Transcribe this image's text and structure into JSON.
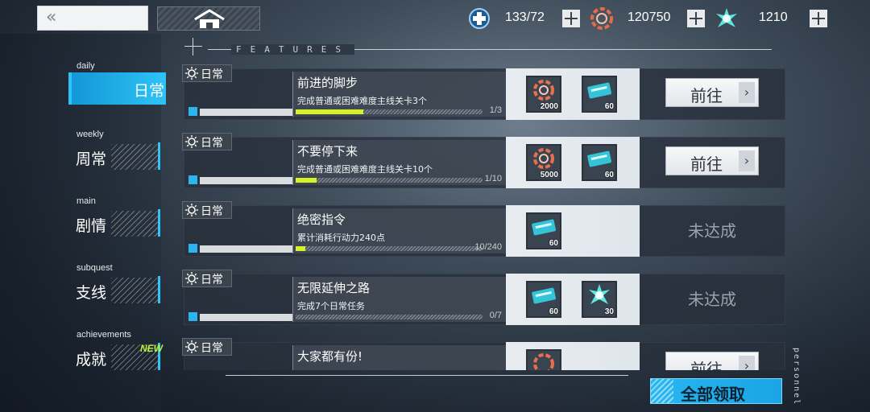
{
  "header": {
    "back_icon": "«",
    "resources": [
      {
        "name": "stamina",
        "icon": "medical-cross-icon",
        "value": "133/72"
      },
      {
        "name": "credits",
        "icon": "gear-coin-icon",
        "value": "120750"
      },
      {
        "name": "crystal",
        "icon": "crystal-burst-icon",
        "value": "1210"
      }
    ]
  },
  "features_label": "FEATURES",
  "nav": [
    {
      "en": "daily",
      "zh": "日常",
      "active": true
    },
    {
      "en": "weekly",
      "zh": "周常"
    },
    {
      "en": "main",
      "zh": "剧情"
    },
    {
      "en": "subquest",
      "zh": "支线"
    },
    {
      "en": "achievements",
      "zh": "成就",
      "badge": "NEW"
    }
  ],
  "tasks": [
    {
      "tag": "日常",
      "title": "前进的脚步",
      "desc": "完成普通或困难难度主线关卡3个",
      "progress": "1/3",
      "progress_fraction": 0.333,
      "rewards": [
        {
          "icon": "gear-coin-icon",
          "qty": "2000"
        },
        {
          "icon": "ticket-card-icon",
          "qty": "60"
        }
      ],
      "action": "前往"
    },
    {
      "tag": "日常",
      "title": "不要停下来",
      "desc": "完成普通或困难难度主线关卡10个",
      "progress": "1/10",
      "progress_fraction": 0.1,
      "rewards": [
        {
          "icon": "gear-coin-icon",
          "qty": "5000"
        },
        {
          "icon": "ticket-card-icon",
          "qty": "60"
        }
      ],
      "action": "前往"
    },
    {
      "tag": "日常",
      "title": "绝密指令",
      "desc": "累计消耗行动力240点",
      "progress": "10/240",
      "progress_fraction": 0.042,
      "rewards": [
        {
          "icon": "ticket-card-icon",
          "qty": "60"
        }
      ],
      "status": "未达成"
    },
    {
      "tag": "日常",
      "title": "无限延伸之路",
      "desc": "完成7个日常任务",
      "progress": "0/7",
      "progress_fraction": 0,
      "rewards": [
        {
          "icon": "ticket-card-icon",
          "qty": "60"
        },
        {
          "icon": "crystal-burst-icon",
          "qty": "30"
        }
      ],
      "status": "未达成"
    },
    {
      "tag": "日常",
      "title": "大家都有份!",
      "rewards": [
        {
          "icon": "gear-coin-icon",
          "qty": ""
        }
      ],
      "action": "前往"
    }
  ],
  "claim_all": "全部领取",
  "side_label": "personnel"
}
